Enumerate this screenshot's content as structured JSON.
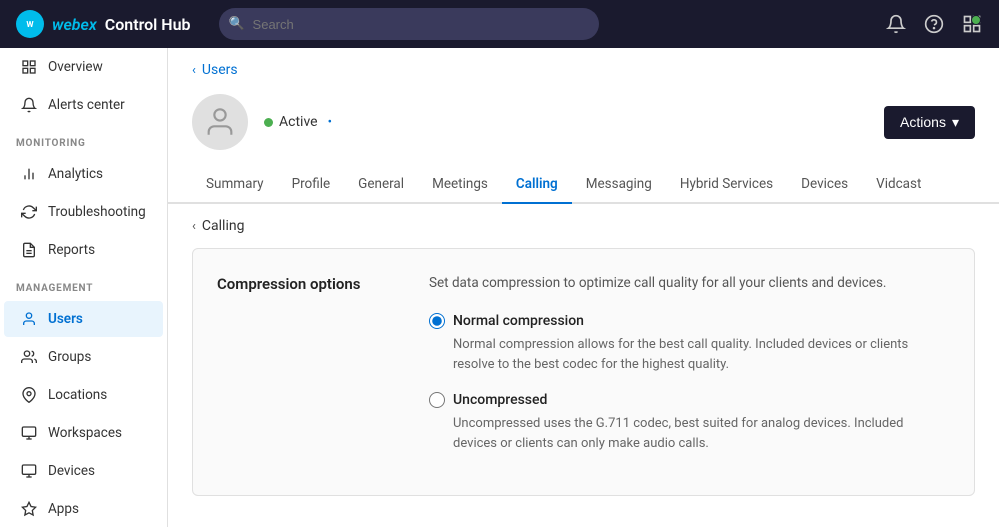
{
  "app": {
    "logo_text": "webex",
    "product_name": "Control Hub",
    "logo_icon": "W"
  },
  "topnav": {
    "search_placeholder": "Search",
    "notifications_icon": "bell",
    "help_icon": "question",
    "apps_icon": "grid"
  },
  "sidebar": {
    "top_items": [
      {
        "id": "overview",
        "label": "Overview",
        "icon": "⊞"
      },
      {
        "id": "alerts",
        "label": "Alerts center",
        "icon": "🔔"
      }
    ],
    "monitoring_label": "MONITORING",
    "monitoring_items": [
      {
        "id": "analytics",
        "label": "Analytics",
        "icon": "📊"
      },
      {
        "id": "troubleshooting",
        "label": "Troubleshooting",
        "icon": "↺"
      },
      {
        "id": "reports",
        "label": "Reports",
        "icon": "📄"
      }
    ],
    "management_label": "MANAGEMENT",
    "management_items": [
      {
        "id": "users",
        "label": "Users",
        "icon": "👤",
        "active": true
      },
      {
        "id": "groups",
        "label": "Groups",
        "icon": "👥"
      },
      {
        "id": "locations",
        "label": "Locations",
        "icon": "📍"
      },
      {
        "id": "workspaces",
        "label": "Workspaces",
        "icon": "🏢"
      },
      {
        "id": "devices",
        "label": "Devices",
        "icon": "💻"
      },
      {
        "id": "apps",
        "label": "Apps",
        "icon": "⬡"
      }
    ]
  },
  "breadcrumb": {
    "parent": "Users",
    "arrow": "‹"
  },
  "user": {
    "status": "Active",
    "status_edit": "•",
    "status_color": "#4caf50"
  },
  "actions_button": {
    "label": "Actions",
    "chevron": "▾"
  },
  "tabs": [
    {
      "id": "summary",
      "label": "Summary"
    },
    {
      "id": "profile",
      "label": "Profile"
    },
    {
      "id": "general",
      "label": "General"
    },
    {
      "id": "meetings",
      "label": "Meetings"
    },
    {
      "id": "calling",
      "label": "Calling",
      "active": true
    },
    {
      "id": "messaging",
      "label": "Messaging"
    },
    {
      "id": "hybrid",
      "label": "Hybrid Services"
    },
    {
      "id": "devices",
      "label": "Devices"
    },
    {
      "id": "vidcast",
      "label": "Vidcast"
    }
  ],
  "sub_breadcrumb": {
    "label": "Calling",
    "arrow": "‹"
  },
  "compression": {
    "title": "Compression options",
    "description": "Set data compression to optimize call quality for all your clients and devices.",
    "options": [
      {
        "id": "normal",
        "label": "Normal compression",
        "description": "Normal compression allows for the best call quality. Included devices or clients resolve to the best codec for the highest quality.",
        "checked": true
      },
      {
        "id": "uncompressed",
        "label": "Uncompressed",
        "description": "Uncompressed uses the G.711 codec, best suited for analog devices. Included devices or clients can only make audio calls.",
        "checked": false
      }
    ]
  }
}
